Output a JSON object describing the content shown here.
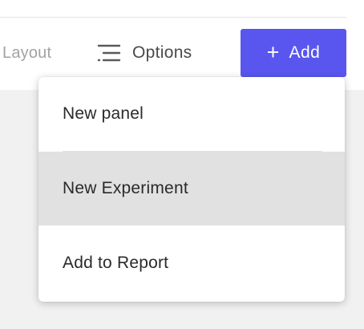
{
  "toolbar": {
    "layout_label": "Layout",
    "options_label": "Options",
    "options_icon": "filter-lines-icon",
    "add_label": "Add",
    "add_icon": "plus-icon",
    "accent_color": "#5956f0"
  },
  "menu": {
    "items": [
      {
        "label": "New panel"
      },
      {
        "label": "New Experiment",
        "state": "hovered"
      },
      {
        "label": "Add to Report"
      }
    ]
  }
}
